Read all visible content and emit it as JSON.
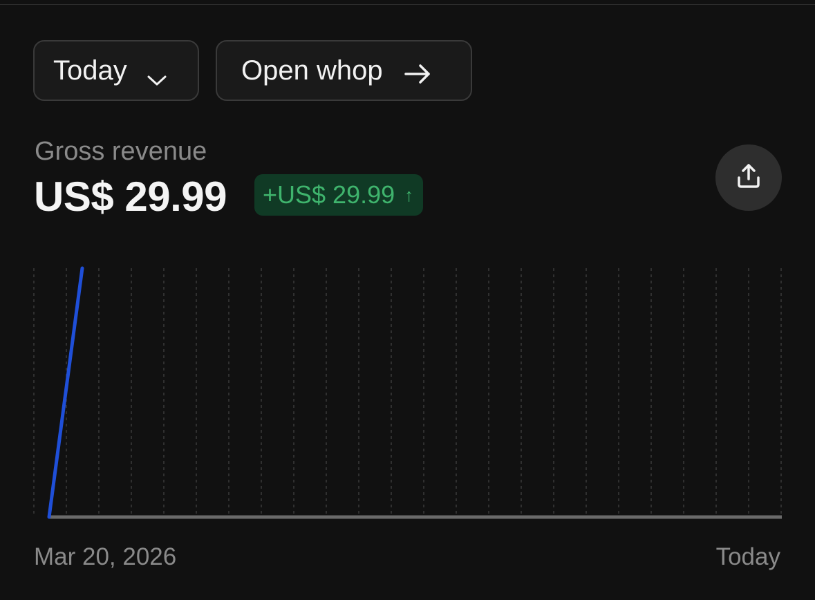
{
  "toolbar": {
    "range_label": "Today",
    "open_label": "Open whop"
  },
  "metric": {
    "label": "Gross revenue",
    "value": "US$ 29.99",
    "delta": "+US$ 29.99",
    "delta_arrow": "↑"
  },
  "icons": {
    "range_dropdown": "chevron-down-icon",
    "open": "arrow-right-icon",
    "share": "share-upload-icon"
  },
  "colors": {
    "background": "#111111",
    "line": "#1f4fd8",
    "positive": "#3fb46d",
    "positive_bg": "#103a25"
  },
  "chart_data": {
    "type": "line",
    "x_labels": [
      "Mar 20, 2026",
      "Today"
    ],
    "series": [
      {
        "values": [
          0,
          29.99
        ]
      }
    ],
    "grid": "vertical-dashed",
    "gridline_count": 24
  }
}
